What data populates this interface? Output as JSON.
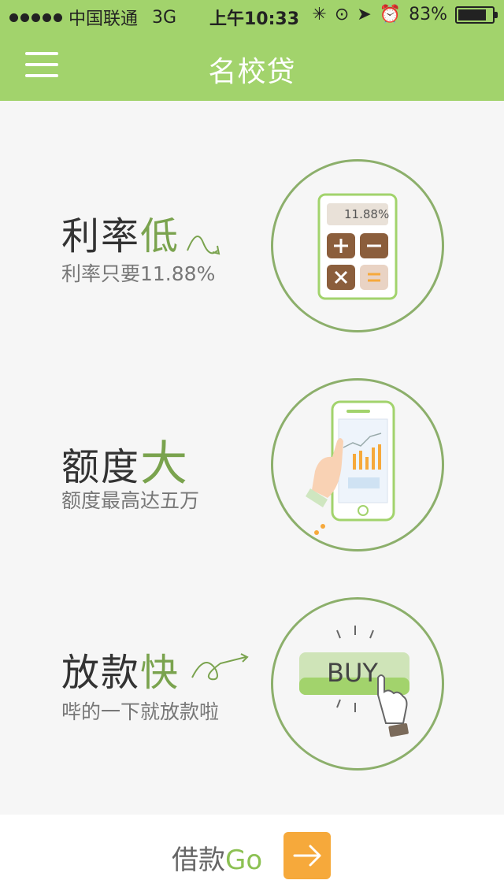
{
  "status_bar": {
    "carrier": "中国联通",
    "network": "3G",
    "time": "上午10:33",
    "battery": "83%",
    "battery_level": 0.83
  },
  "navbar": {
    "title": "名校贷",
    "menu_icon": "hamburger-menu-icon"
  },
  "features": [
    {
      "title": "利率",
      "highlight": "低",
      "subtitle": "利率只要11.88%",
      "illustration": "calculator-icon",
      "calculator_display": "11.88%"
    },
    {
      "title": "额度",
      "highlight": "大",
      "subtitle": "额度最高达五万",
      "illustration": "phone-chart-icon"
    },
    {
      "title": "放款",
      "highlight": "快",
      "subtitle": "哔的一下就放款啦",
      "illustration": "buy-button-icon",
      "buy_label": "BUY"
    }
  ],
  "bottom": {
    "label": "借款",
    "go": "Go",
    "arrow_icon": "arrow-right-icon"
  },
  "colors": {
    "primary_green": "#a2d36c",
    "dark_green": "#7aa34e",
    "circle_border": "#8caf6b",
    "orange": "#f6a93b"
  }
}
